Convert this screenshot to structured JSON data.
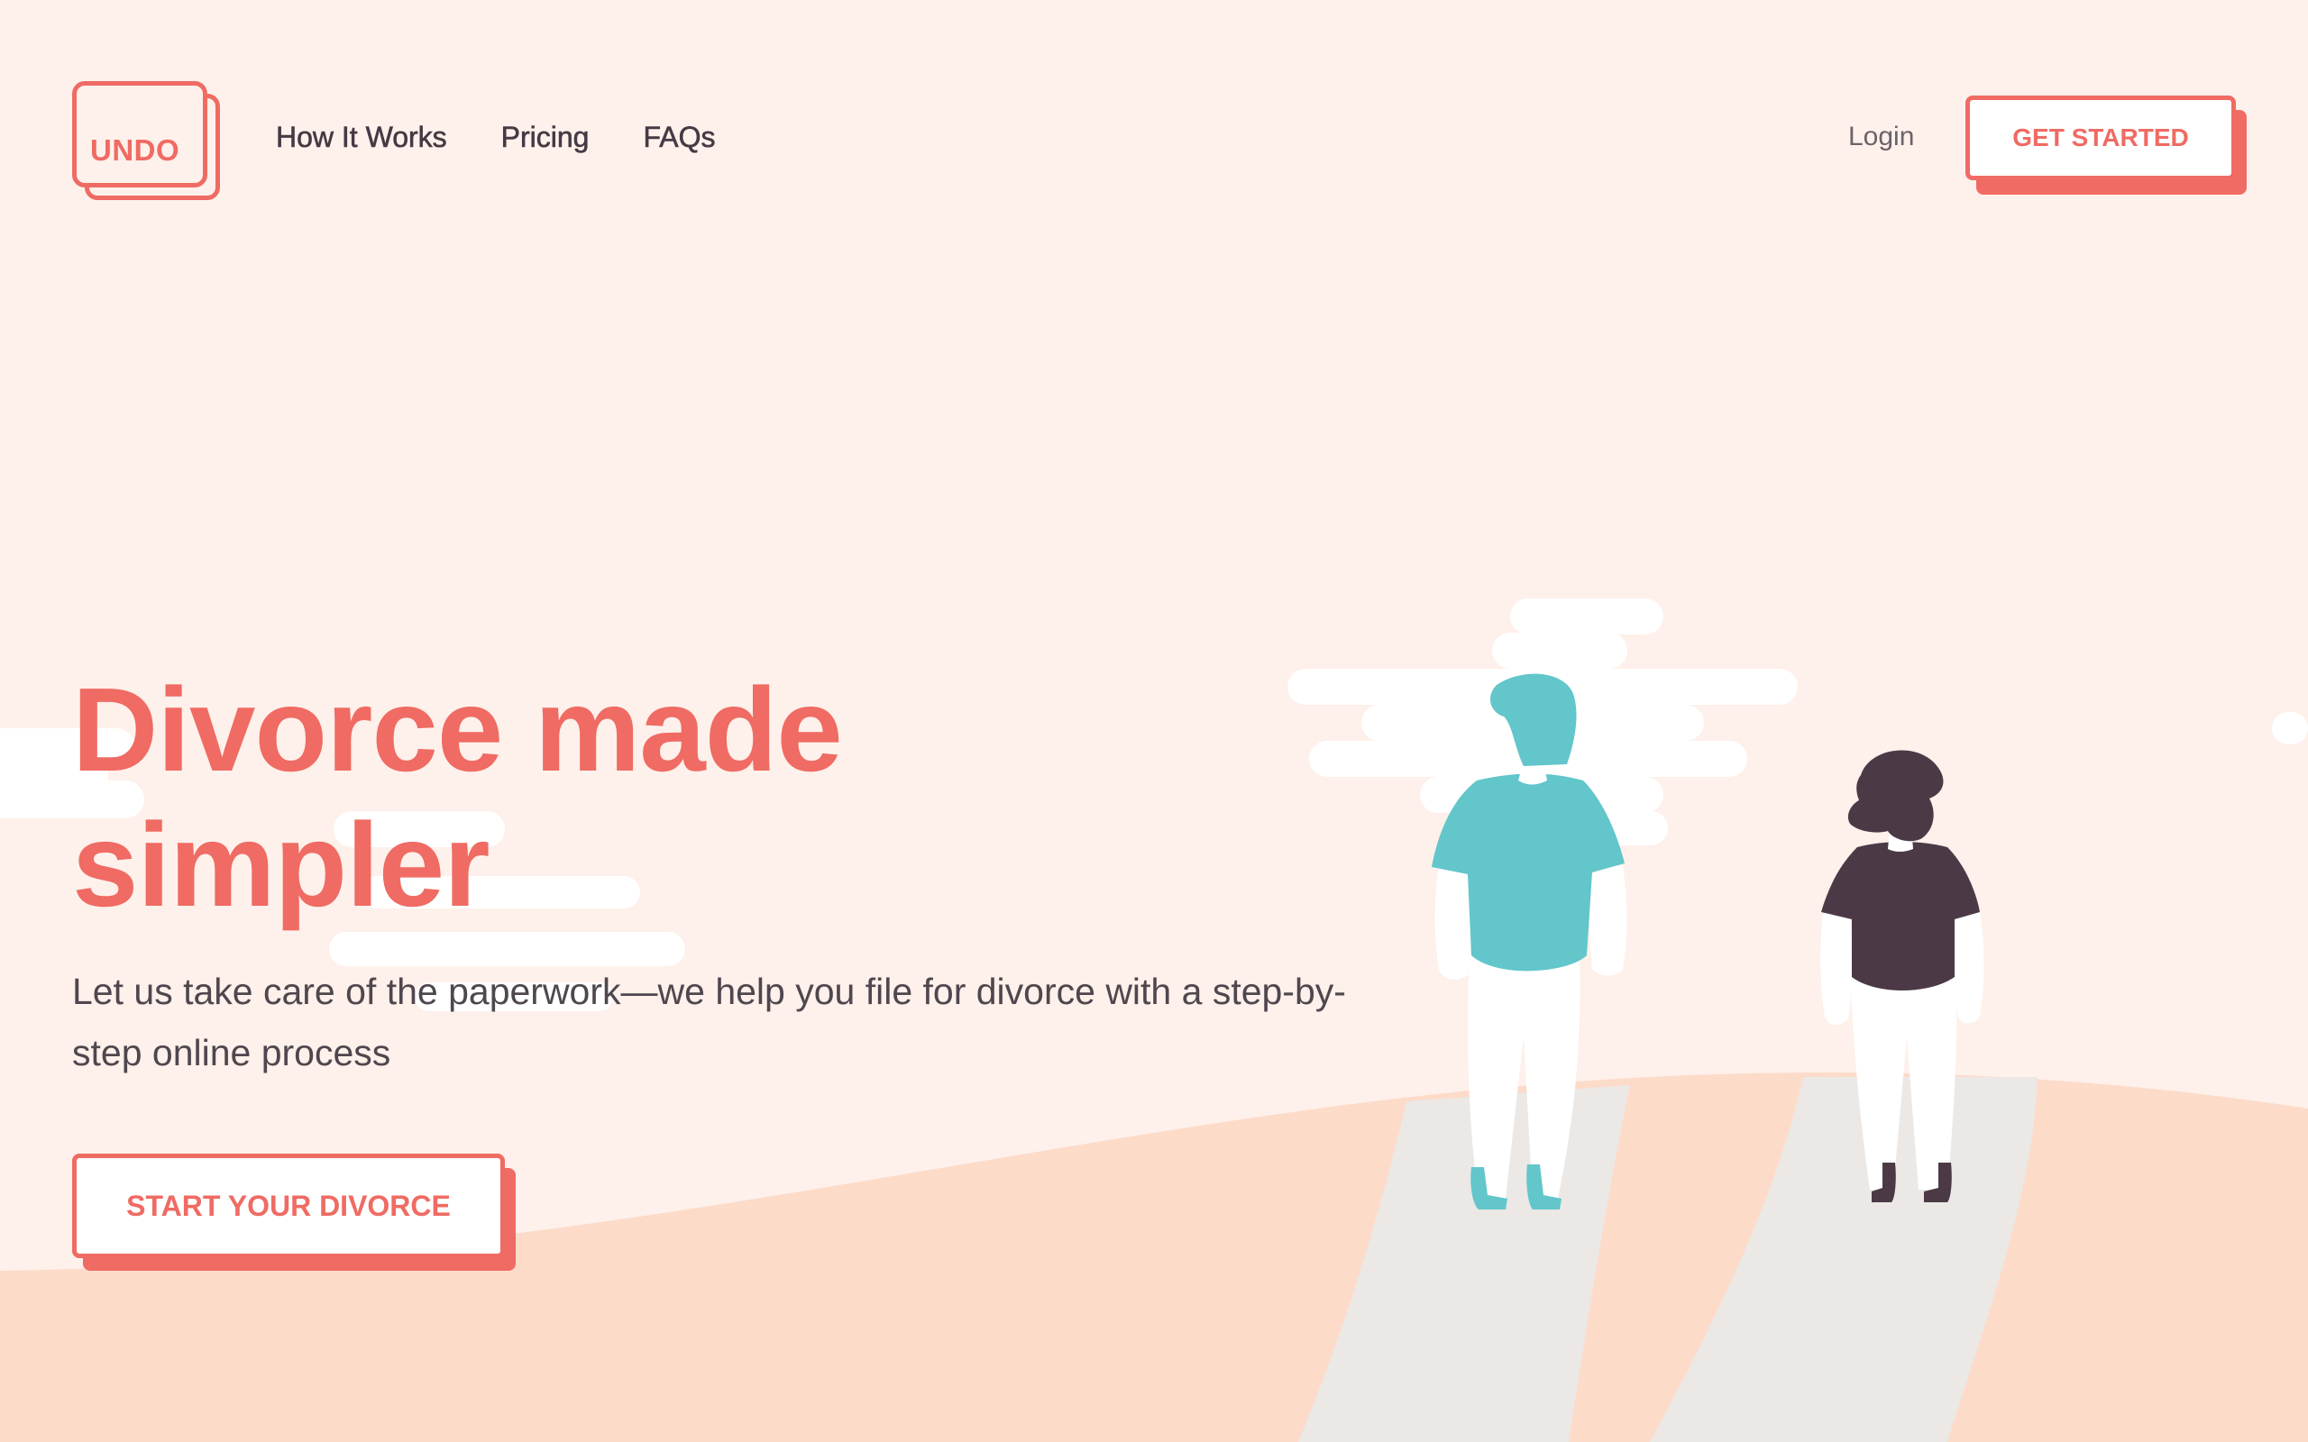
{
  "brand": {
    "logo_text": "UNDO",
    "accent_color": "#ef6b63",
    "background_color": "#fef0ea"
  },
  "nav": {
    "items": [
      {
        "label": "How It Works"
      },
      {
        "label": "Pricing"
      },
      {
        "label": "FAQs"
      }
    ],
    "login_label": "Login",
    "get_started_label": "GET STARTED"
  },
  "hero": {
    "title": "Divorce made simpler",
    "subtitle": "Let us take care of the paperwork—we help you file for divorce with a step-by-step online process",
    "cta_label": "START YOUR DIVORCE"
  },
  "illustration": {
    "figures": [
      {
        "name": "teal-shirt-person",
        "shirt_color": "#62c6cb"
      },
      {
        "name": "dark-shirt-person",
        "shirt_color": "#4b3a46"
      }
    ]
  }
}
